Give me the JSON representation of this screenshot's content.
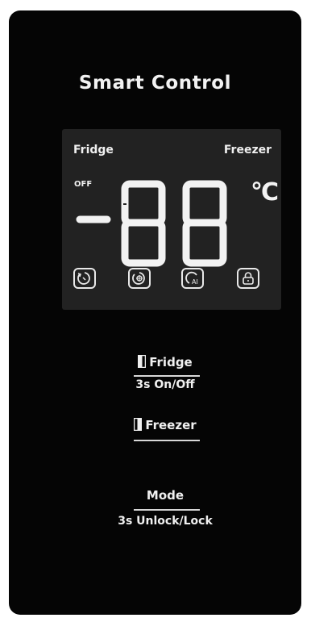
{
  "panel": {
    "title": "Smart Control",
    "display": {
      "fridge_label": "Fridge",
      "freezer_label": "Freezer",
      "off_label": "OFF",
      "temperature": "-88",
      "unit": "°C",
      "icons": [
        "timer-icon",
        "fan-icon",
        "ai-icon",
        "lock-icon"
      ]
    },
    "buttons": {
      "fridge": {
        "label": "Fridge",
        "hold_text": "3s On/Off"
      },
      "freezer": {
        "label": "Freezer"
      },
      "mode": {
        "label": "Mode",
        "hold_text": "3s Unlock/Lock"
      }
    },
    "colors": {
      "panel": "#050505",
      "display": "#222222",
      "segment": "#f2f2f2"
    }
  }
}
